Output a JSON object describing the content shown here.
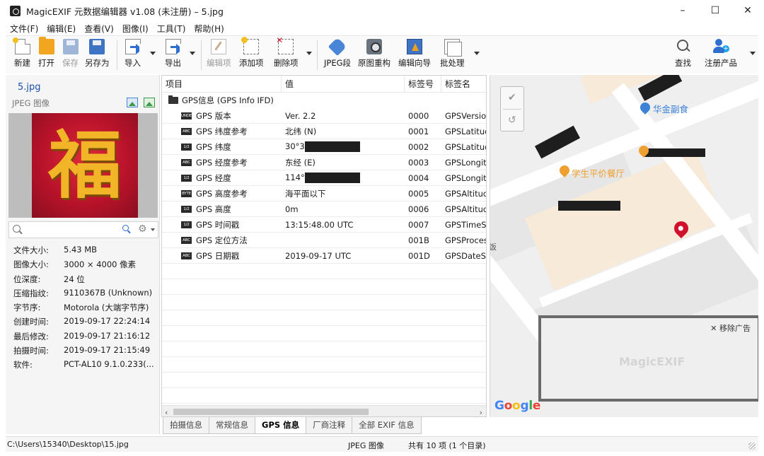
{
  "window": {
    "title": "MagicEXIF 元数据编辑器 v1.08 (未注册)  –  5.jpg",
    "minimize": "–",
    "maximize": "☐",
    "close": "✕"
  },
  "menu": [
    "文件(F)",
    "编辑(E)",
    "查看(V)",
    "图像(I)",
    "工具(T)",
    "帮助(H)"
  ],
  "toolbar": {
    "new": "新建",
    "open": "打开",
    "save": "保存",
    "save_as": "另存为",
    "import": "导入",
    "export": "导出",
    "edit_item": "编辑项",
    "add_item": "添加项",
    "delete_item": "删除项",
    "jpeg_segment": "JPEG段",
    "rebuild": "原图重构",
    "wizard": "编辑向导",
    "batch": "批处理",
    "find": "查找",
    "register": "注册产品"
  },
  "file_panel": {
    "name": "5.jpg",
    "type": "JPEG 图像",
    "thumbnail_char": "福",
    "search_placeholder": "",
    "properties": [
      {
        "key": "文件大小:",
        "value": "5.43 MB"
      },
      {
        "key": "图像大小:",
        "value": "3000 × 4000 像素"
      },
      {
        "key": "位深度:",
        "value": "24 位"
      },
      {
        "key": "压缩指纹:",
        "value": "9110367B (Unknown)"
      },
      {
        "key": "字节序:",
        "value": "Motorola (大端字节序)"
      },
      {
        "key": "创建时间:",
        "value": "2019-09-17 22:24:14"
      },
      {
        "key": "最后修改:",
        "value": "2019-09-17 21:16:12"
      },
      {
        "key": "拍摄时间:",
        "value": "2019-09-17 21:15:49"
      },
      {
        "key": "软件:",
        "value": "PCT-AL10 9.1.0.233(..."
      }
    ]
  },
  "table": {
    "headers": [
      "项目",
      "值",
      "标签号",
      "标签名"
    ],
    "group": "GPS信息 (GPS Info IFD)",
    "rows": [
      {
        "badge": "UNDEF",
        "item": "GPS 版本",
        "value": "Ver. 2.2",
        "tag": "0000",
        "name": "GPSVersionID",
        "redacted": false
      },
      {
        "badge": "ABC",
        "item": "GPS 纬度参考",
        "value": "北纬 (N)",
        "tag": "0001",
        "name": "GPSLatitudeRef",
        "redacted": false
      },
      {
        "badge": "1/2",
        "item": "GPS 纬度",
        "value": "30°3",
        "tag": "0002",
        "name": "GPSLatitude",
        "redacted": true
      },
      {
        "badge": "ABC",
        "item": "GPS 经度参考",
        "value": "东经 (E)",
        "tag": "0003",
        "name": "GPSLongitudeRef",
        "redacted": false
      },
      {
        "badge": "1/2",
        "item": "GPS 经度",
        "value": "114°",
        "tag": "0004",
        "name": "GPSLongitude",
        "redacted": true
      },
      {
        "badge": "BYTE",
        "item": "GPS 高度参考",
        "value": "海平面以下",
        "tag": "0005",
        "name": "GPSAltitudeRef",
        "redacted": false
      },
      {
        "badge": "1/2",
        "item": "GPS 高度",
        "value": "0m",
        "tag": "0006",
        "name": "GPSAltitude",
        "redacted": false
      },
      {
        "badge": "1/2",
        "item": "GPS 时间戳",
        "value": "13:15:48.00 UTC",
        "tag": "0007",
        "name": "GPSTimeStamp",
        "redacted": false
      },
      {
        "badge": "ABC",
        "item": "GPS 定位方法",
        "value": "",
        "tag": "001B",
        "name": "GPSProcessingMethod",
        "redacted": false
      },
      {
        "badge": "ABC",
        "item": "GPS 日期戳",
        "value": "2019-09-17 UTC",
        "tag": "001D",
        "name": "GPSDateStamp",
        "redacted": false
      }
    ]
  },
  "tabs": [
    {
      "label": "拍摄信息",
      "active": false
    },
    {
      "label": "常规信息",
      "active": false
    },
    {
      "label": "GPS 信息",
      "active": true
    },
    {
      "label": "厂商注释",
      "active": false
    },
    {
      "label": "全部 EXIF 信息",
      "active": false
    }
  ],
  "map": {
    "poi_1": "华金副食",
    "poi_2": "学生平价餐厅",
    "edge_text": "饭",
    "ad_close": "✕ 移除广告",
    "ad_watermark": "MagicEXIF",
    "google": [
      "G",
      "o",
      "o",
      "g",
      "l",
      "e"
    ],
    "google_colors": [
      "#4285f4",
      "#ea4335",
      "#fbbc05",
      "#4285f4",
      "#34a853",
      "#ea4335"
    ],
    "poi_1_color": "#3b82d8",
    "poi_2_color": "#f0a030",
    "pin_color": "#d0112b"
  },
  "status": {
    "path": "C:\\Users\\15340\\Desktop\\15.jpg",
    "type": "JPEG 图像",
    "summary": "共有 10 项 (1 个目录)"
  }
}
